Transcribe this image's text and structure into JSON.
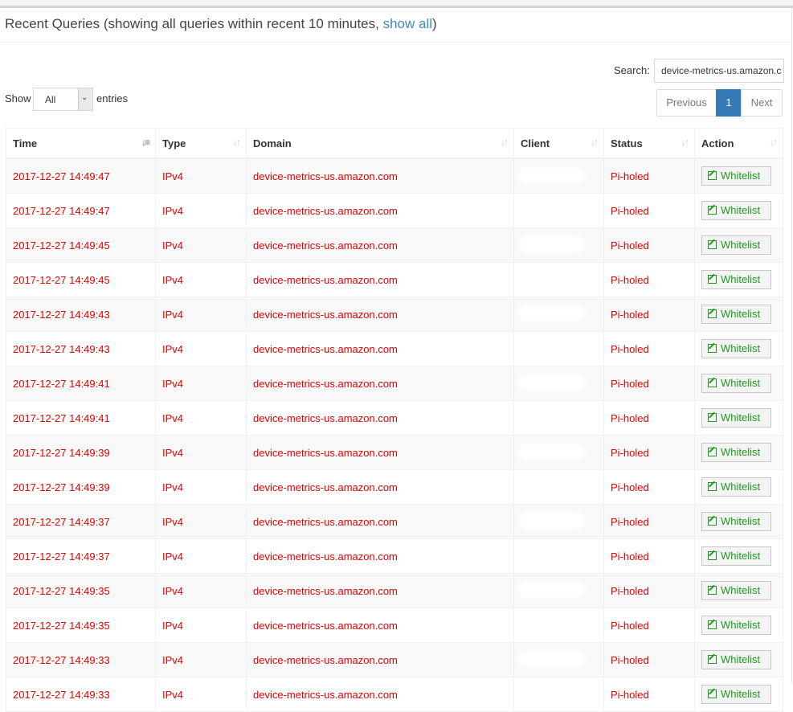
{
  "header": {
    "title_prefix": "Recent Queries (showing all queries within recent 10 minutes, ",
    "show_all_link": "show all",
    "title_suffix": ")"
  },
  "search": {
    "label": "Search:",
    "value": "device-metrics-us.amazon.c"
  },
  "length": {
    "show_label": "Show",
    "selected": "All",
    "entries_label": "entries"
  },
  "pagination": {
    "previous": "Previous",
    "current": "1",
    "next": "Next"
  },
  "columns": [
    "Time",
    "Type",
    "Domain",
    "Client",
    "Status",
    "Action"
  ],
  "colors": {
    "blocked_text": "#e00000",
    "link": "#3c8dbc",
    "active_page": "#337ab7",
    "whitelist_btn": "#1d9a1d"
  },
  "icons": {
    "sort_active": "sort-descending-icon",
    "sort": "sort-icon",
    "whitelist": "edit-icon"
  },
  "rows": [
    {
      "time": "2017-12-27 14:49:47",
      "type": "IPv4",
      "domain": "device-metrics-us.amazon.com",
      "client": "",
      "status": "Pi-holed",
      "action": "Whitelist"
    },
    {
      "time": "2017-12-27 14:49:47",
      "type": "IPv4",
      "domain": "device-metrics-us.amazon.com",
      "client": "",
      "status": "Pi-holed",
      "action": "Whitelist"
    },
    {
      "time": "2017-12-27 14:49:45",
      "type": "IPv4",
      "domain": "device-metrics-us.amazon.com",
      "client": "",
      "status": "Pi-holed",
      "action": "Whitelist"
    },
    {
      "time": "2017-12-27 14:49:45",
      "type": "IPv4",
      "domain": "device-metrics-us.amazon.com",
      "client": "",
      "status": "Pi-holed",
      "action": "Whitelist"
    },
    {
      "time": "2017-12-27 14:49:43",
      "type": "IPv4",
      "domain": "device-metrics-us.amazon.com",
      "client": "",
      "status": "Pi-holed",
      "action": "Whitelist"
    },
    {
      "time": "2017-12-27 14:49:43",
      "type": "IPv4",
      "domain": "device-metrics-us.amazon.com",
      "client": "",
      "status": "Pi-holed",
      "action": "Whitelist"
    },
    {
      "time": "2017-12-27 14:49:41",
      "type": "IPv4",
      "domain": "device-metrics-us.amazon.com",
      "client": "",
      "status": "Pi-holed",
      "action": "Whitelist"
    },
    {
      "time": "2017-12-27 14:49:41",
      "type": "IPv4",
      "domain": "device-metrics-us.amazon.com",
      "client": "",
      "status": "Pi-holed",
      "action": "Whitelist"
    },
    {
      "time": "2017-12-27 14:49:39",
      "type": "IPv4",
      "domain": "device-metrics-us.amazon.com",
      "client": "",
      "status": "Pi-holed",
      "action": "Whitelist"
    },
    {
      "time": "2017-12-27 14:49:39",
      "type": "IPv4",
      "domain": "device-metrics-us.amazon.com",
      "client": "",
      "status": "Pi-holed",
      "action": "Whitelist"
    },
    {
      "time": "2017-12-27 14:49:37",
      "type": "IPv4",
      "domain": "device-metrics-us.amazon.com",
      "client": "",
      "status": "Pi-holed",
      "action": "Whitelist"
    },
    {
      "time": "2017-12-27 14:49:37",
      "type": "IPv4",
      "domain": "device-metrics-us.amazon.com",
      "client": "",
      "status": "Pi-holed",
      "action": "Whitelist"
    },
    {
      "time": "2017-12-27 14:49:35",
      "type": "IPv4",
      "domain": "device-metrics-us.amazon.com",
      "client": "",
      "status": "Pi-holed",
      "action": "Whitelist"
    },
    {
      "time": "2017-12-27 14:49:35",
      "type": "IPv4",
      "domain": "device-metrics-us.amazon.com",
      "client": "",
      "status": "Pi-holed",
      "action": "Whitelist"
    },
    {
      "time": "2017-12-27 14:49:33",
      "type": "IPv4",
      "domain": "device-metrics-us.amazon.com",
      "client": "",
      "status": "Pi-holed",
      "action": "Whitelist"
    },
    {
      "time": "2017-12-27 14:49:33",
      "type": "IPv4",
      "domain": "device-metrics-us.amazon.com",
      "client": "",
      "status": "Pi-holed",
      "action": "Whitelist"
    }
  ]
}
